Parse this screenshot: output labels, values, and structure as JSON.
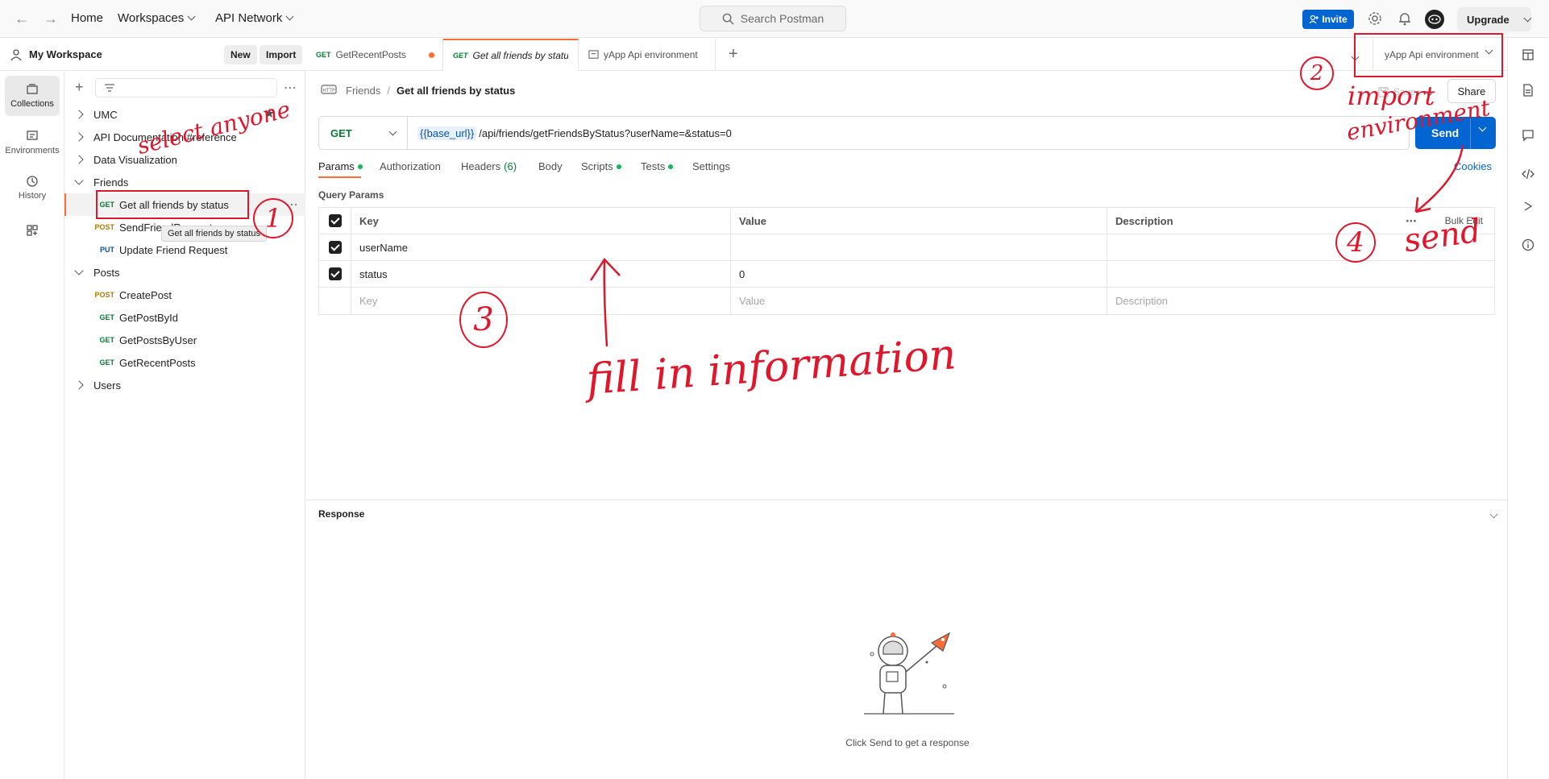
{
  "topbar": {
    "home": "Home",
    "workspaces": "Workspaces",
    "api_network": "API Network",
    "search_placeholder": "Search Postman",
    "invite": "Invite",
    "upgrade": "Upgrade"
  },
  "rail": {
    "collections": "Collections",
    "environments": "Environments",
    "history": "History"
  },
  "workspace": {
    "title": "My Workspace",
    "new_label": "New",
    "import_label": "Import"
  },
  "tree": {
    "umc": "UMC",
    "api_docs": "API Documentation #reference",
    "data_viz": "Data Visualization",
    "friends": "Friends",
    "friends_items": [
      {
        "method": "GET",
        "name": "Get all friends by status"
      },
      {
        "method": "POST",
        "name": "SendFriendRequest"
      },
      {
        "method": "PUT",
        "name": "Update Friend Request"
      }
    ],
    "tooltip": "Get all friends by status",
    "posts": "Posts",
    "posts_items": [
      {
        "method": "POST",
        "name": "CreatePost"
      },
      {
        "method": "GET",
        "name": "GetPostById"
      },
      {
        "method": "GET",
        "name": "GetPostsByUser"
      },
      {
        "method": "GET",
        "name": "GetRecentPosts"
      }
    ],
    "users": "Users"
  },
  "tabs": [
    {
      "method": "GET",
      "label": "GetRecentPosts"
    },
    {
      "method": "GET",
      "label": "Get all friends by status"
    },
    {
      "method": "",
      "label": "yApp Api environment"
    }
  ],
  "env_select": "yApp Api environment",
  "breadcrumb": {
    "parent": "Friends",
    "separator": "/",
    "current": "Get all friends by status"
  },
  "actions": {
    "save": "Save",
    "share": "Share"
  },
  "request": {
    "method": "GET",
    "url_var": "{{base_url}}",
    "url_path": "/api/friends/getFriendsByStatus?userName=&status=0",
    "send": "Send"
  },
  "reqtabs": {
    "params": "Params",
    "authorization": "Authorization",
    "headers": "Headers",
    "headers_count": "(6)",
    "body": "Body",
    "scripts": "Scripts",
    "tests": "Tests",
    "settings": "Settings",
    "cookies": "Cookies"
  },
  "params": {
    "title": "Query Params",
    "col_key": "Key",
    "col_value": "Value",
    "col_description": "Description",
    "bulk_edit": "Bulk Edit",
    "rows": [
      {
        "key": "userName",
        "value": ""
      },
      {
        "key": "status",
        "value": "0"
      }
    ],
    "ph_key": "Key",
    "ph_value": "Value",
    "ph_description": "Description"
  },
  "response": {
    "title": "Response",
    "empty_text": "Click Send to get a response"
  },
  "annotations": {
    "n1": "1",
    "n2": "2",
    "n3": "3",
    "n4": "4",
    "select": "select anyone",
    "import": "import",
    "environment": "environment",
    "send": "send",
    "fill": "fill in information"
  },
  "colors": {
    "accent_blue": "#0265d2",
    "get_green": "#007f31",
    "post_orange": "#ad7a03",
    "put_blue": "#0053b8",
    "annotation_red": "#e0162b",
    "tab_active": "#ff6c37"
  }
}
